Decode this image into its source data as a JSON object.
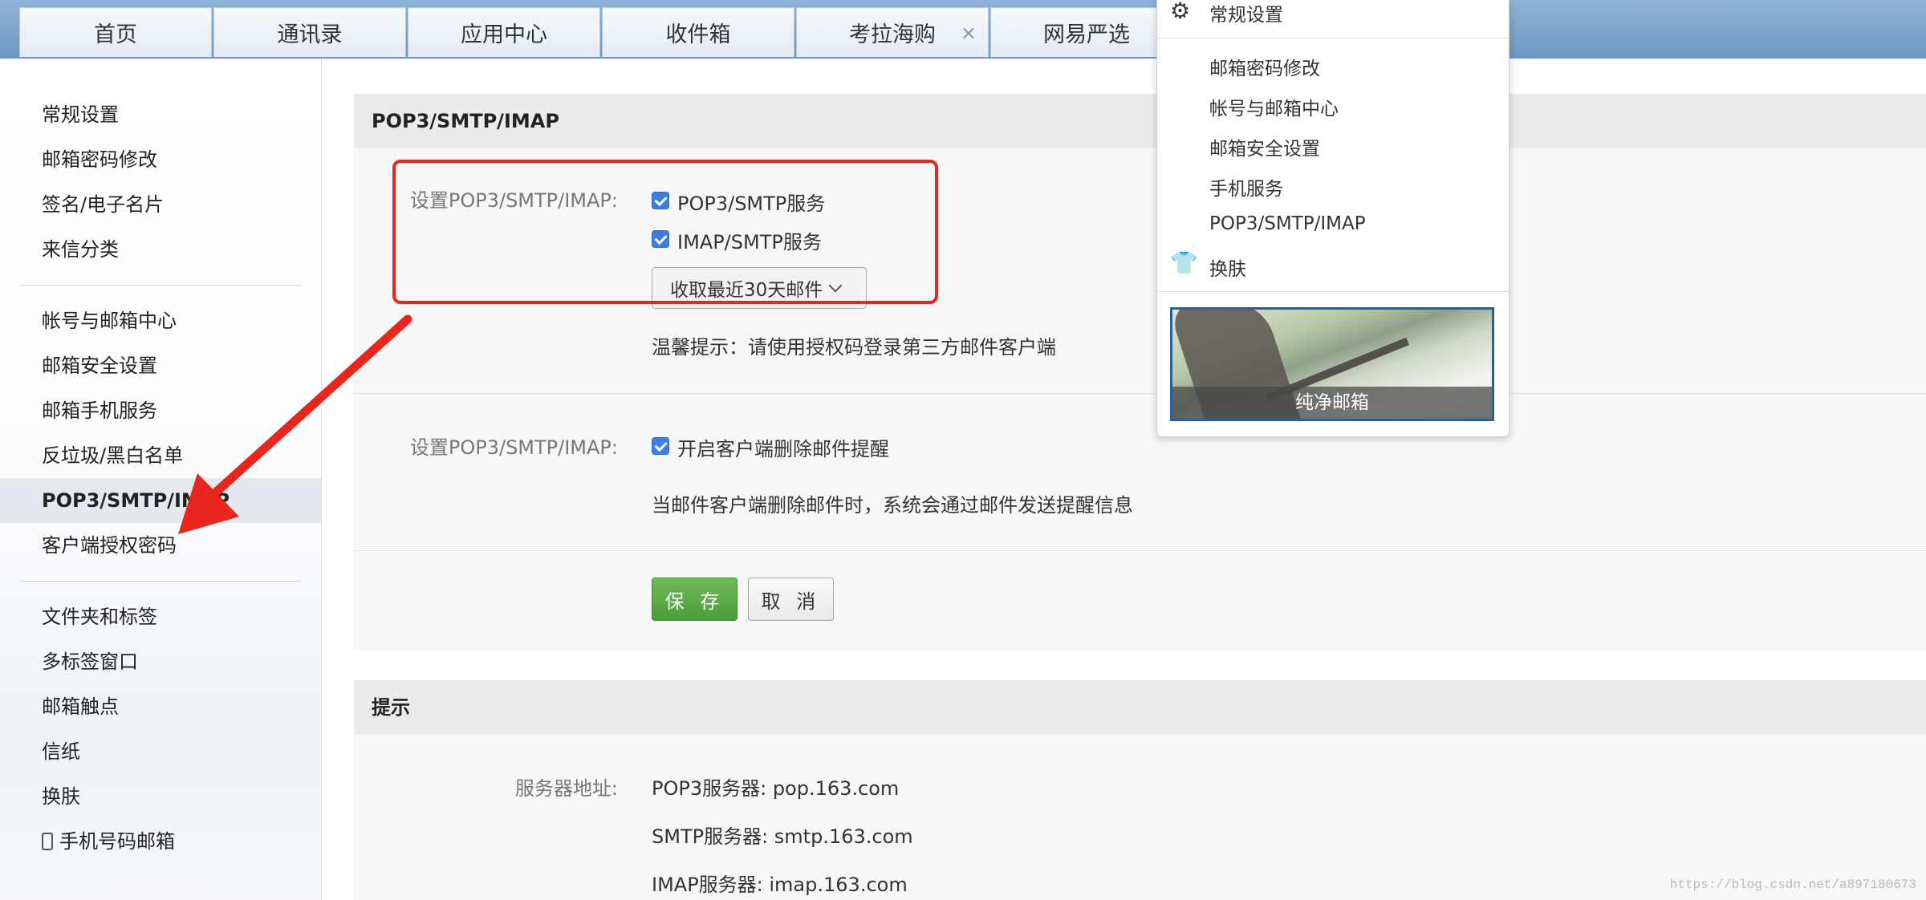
{
  "tabs": [
    {
      "label": "首页"
    },
    {
      "label": "通讯录"
    },
    {
      "label": "应用中心"
    },
    {
      "label": "收件箱"
    },
    {
      "label": "考拉海购",
      "closable": true
    },
    {
      "label": "网易严选"
    }
  ],
  "close_glyph": "×",
  "sidebar": {
    "group1": [
      "常规设置",
      "邮箱密码修改",
      "签名/电子名片",
      "来信分类"
    ],
    "group2": [
      "帐号与邮箱中心",
      "邮箱安全设置",
      "邮箱手机服务",
      "反垃圾/黑白名单",
      "POP3/SMTP/IMAP",
      "客户端授权密码"
    ],
    "group3": [
      "文件夹和标签",
      "多标签窗口",
      "邮箱触点",
      "信纸",
      "换肤",
      "手机号码邮箱"
    ],
    "active": "POP3/SMTP/IMAP"
  },
  "section_pop": {
    "title": "POP3/SMTP/IMAP",
    "label1": "设置POP3/SMTP/IMAP:",
    "opt_pop3": "POP3/SMTP服务",
    "opt_imap": "IMAP/SMTP服务",
    "pop3_checked": true,
    "imap_checked": true,
    "fetch_select": "收取最近30天邮件",
    "hint": "温馨提示：请使用授权码登录第三方邮件客户端",
    "label2": "设置POP3/SMTP/IMAP:",
    "opt_delete_notice": "开启客户端删除邮件提醒",
    "delete_notice_checked": true,
    "delete_desc": "当邮件客户端删除邮件时，系统会通过邮件发送提醒信息",
    "save": "保 存",
    "cancel": "取 消"
  },
  "section_tips": {
    "title": "提示",
    "label": "服务器地址:",
    "pop3": "POP3服务器: pop.163.com",
    "smtp": "SMTP服务器: smtp.163.com",
    "imap": "IMAP服务器: imap.163.com"
  },
  "dropdown": {
    "items": [
      "常规设置",
      "邮箱密码修改",
      "帐号与邮箱中心",
      "邮箱安全设置",
      "手机服务",
      "POP3/SMTP/IMAP",
      "换肤"
    ],
    "skin_label": "纯净邮箱"
  },
  "icons": {
    "settings": "gear-icon",
    "skin": "tshirt-icon",
    "phone": "phone-icon"
  },
  "colors": {
    "annotation": "#e8261d",
    "save_button": "#4a9b39",
    "checkbox": "#3d7fe0"
  },
  "watermark": "https://blog.csdn.net/a897180673"
}
